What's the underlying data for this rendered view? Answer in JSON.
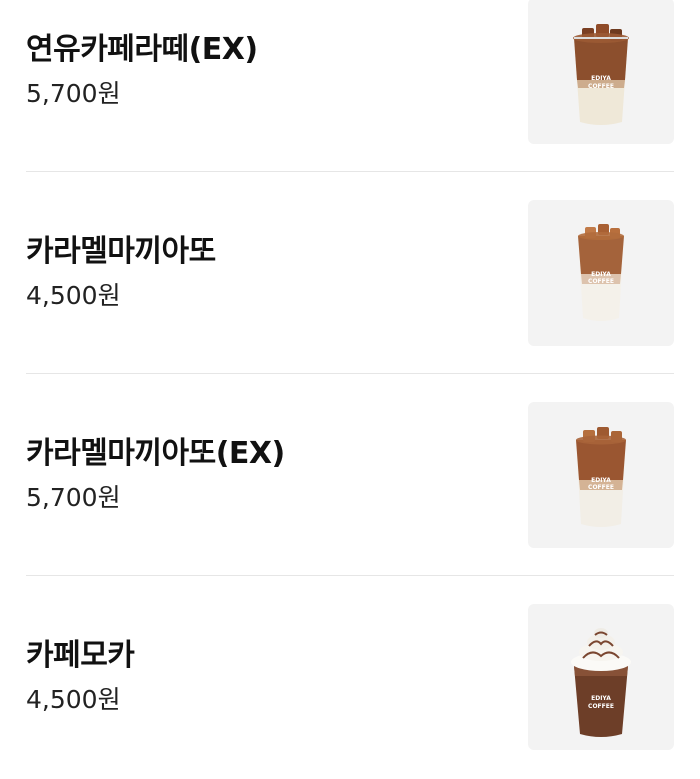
{
  "menu": {
    "items": [
      {
        "name": "연유카페라떼(EX)",
        "price": "5,700원",
        "image_icon": "iced-condensed-milk-latte-cup",
        "cup_brand_line1": "EDIYA",
        "cup_brand_line2": "COFFEE"
      },
      {
        "name": "카라멜마끼아또",
        "price": "4,500원",
        "image_icon": "iced-caramel-macchiato-cup",
        "cup_brand_line1": "EDIYA",
        "cup_brand_line2": "COFFEE"
      },
      {
        "name": "카라멜마끼아또(EX)",
        "price": "5,700원",
        "image_icon": "iced-caramel-macchiato-ex-cup",
        "cup_brand_line1": "EDIYA",
        "cup_brand_line2": "COFFEE"
      },
      {
        "name": "카페모카",
        "price": "4,500원",
        "image_icon": "iced-cafe-mocha-whipped-cup",
        "cup_brand_line1": "EDIYA",
        "cup_brand_line2": "COFFEE"
      }
    ]
  },
  "colors": {
    "thumb_background": "#f3f3f3",
    "divider": "#e6e6e6",
    "coffee": "#8a4a2a",
    "milk": "#f1ece0",
    "mocha": "#6a3b26"
  }
}
